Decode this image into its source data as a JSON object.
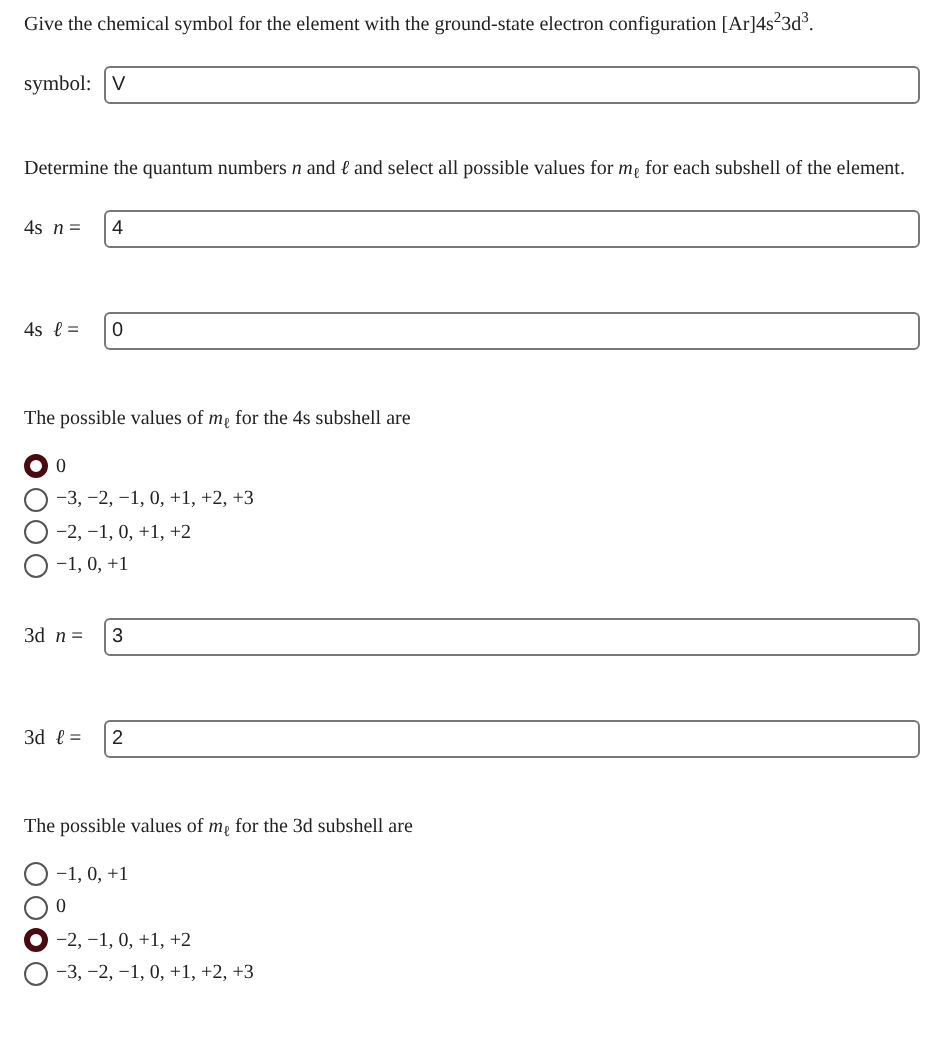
{
  "question": "Give the chemical symbol for the element with the ground-state electron configuration [Ar]4s$^{2}$3d$^{3}$.",
  "symbol_field": {
    "label": "symbol:",
    "value": "V"
  },
  "instruction": "Determine the quantum numbers *n* and *ℓ* and select all possible values for *m*$_{ℓ}$ for each subshell of the element.",
  "subshells": [
    {
      "n_field": {
        "label": "4s  *n* =",
        "value": "4"
      },
      "l_field": {
        "label": "4s  *ℓ* =",
        "value": "0"
      },
      "prompt": "The possible values of *m*$_{ℓ}$ for the 4s subshell are",
      "options": [
        {
          "label": "0",
          "selected": true
        },
        {
          "label": "−3, −2, −1, 0, +1, +2, +3",
          "selected": false
        },
        {
          "label": "−2, −1, 0, +1, +2",
          "selected": false
        },
        {
          "label": "−1, 0, +1",
          "selected": false
        }
      ]
    },
    {
      "n_field": {
        "label": "3d  *n* =",
        "value": "3"
      },
      "l_field": {
        "label": "3d  *ℓ* =",
        "value": "2"
      },
      "prompt": "The possible values of *m*$_{ℓ}$ for the 3d subshell are",
      "options": [
        {
          "label": "−1, 0, +1",
          "selected": false
        },
        {
          "label": "0",
          "selected": false
        },
        {
          "label": "−2, −1, 0, +1, +2",
          "selected": true
        },
        {
          "label": "−3, −2, −1, 0, +1, +2, +3",
          "selected": false
        }
      ]
    }
  ]
}
